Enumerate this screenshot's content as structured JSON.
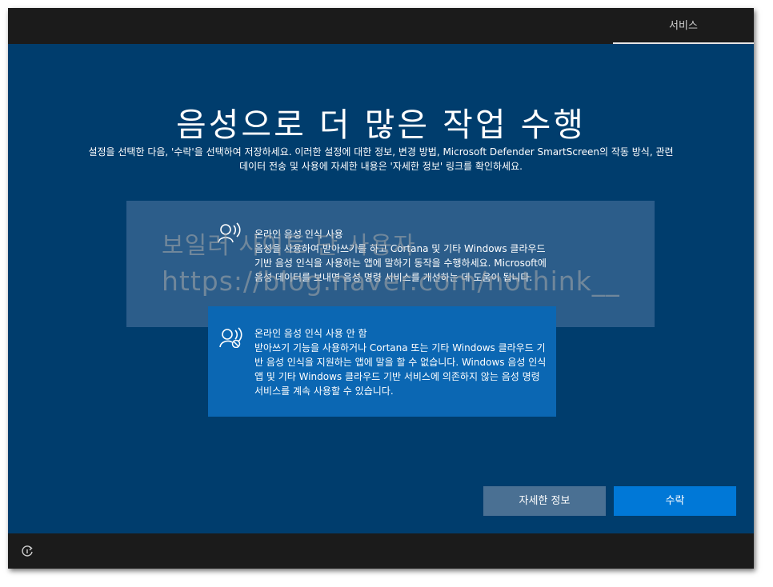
{
  "header": {
    "tab_label": "서비스"
  },
  "title": "음성으로 더 많은 작업 수행",
  "subtitle": {
    "line1": "설정을 선택한 다음, '수락'을 선택하여 저장하세요. 이러한 설정에 대한 정보, 변경 방법, Microsoft Defender SmartScreen의 작동 방식, 관련",
    "line2": "데이터 전송 및 사용에 자세한 내용은 '자세한 정보' 링크를 확인하세요."
  },
  "options": [
    {
      "icon": "speech-on-icon",
      "title": "온라인 음성 인식 사용",
      "description": "음성을 사용하여 받아쓰기를 하고 Cortana 및 기타 Windows 클라우드 기반 음성 인식을 사용하는 앱에 말하기 동작을 수행하세요. Microsoft에 음성 데이터를 보내면 음성 명령 서비스를 개선하는 데 도움이 됩니다."
    },
    {
      "icon": "speech-off-icon",
      "title": "온라인 음성 인식 사용 안 함",
      "description": "받아쓰기 기능을 사용하거나 Cortana 또는 기타 Windows 클라우드 기반 음성 인식을 지원하는 앱에 말을 할 수 없습니다. Windows 음성 인식 앱 및 기타 Windows 클라우드 기반 서비스에 의존하지 않는 음성 명령 서비스를 계속 사용할 수 있습니다."
    }
  ],
  "watermark": {
    "line1": "보일러 사이트 단 사용자",
    "line2": "https://blog.naver.com/nothink__"
  },
  "buttons": {
    "more_info": "자세한 정보",
    "accept": "수락"
  },
  "footer": {
    "icon": "accessibility-icon"
  },
  "colors": {
    "background": "#003d6d",
    "bar": "#1b1b1b",
    "selected_option": "#0b67b3",
    "unselected_option": "#2c5d8a",
    "accept_button": "#0078d7",
    "more_button": "#4a7093"
  }
}
